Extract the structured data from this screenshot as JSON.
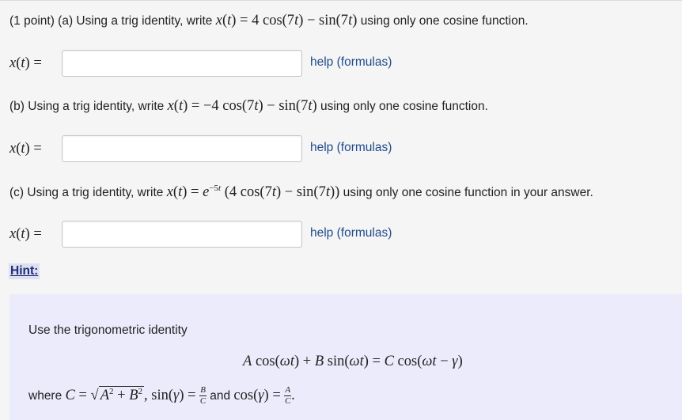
{
  "problem": {
    "part_a": {
      "intro": "(1 point) (a) Using a trig identity, write",
      "equation": "x(t) = 4 cos(7t) − sin(7t)",
      "suffix": "using only one cosine function."
    },
    "part_b": {
      "intro": "(b) Using a trig identity, write",
      "equation": "x(t) = −4 cos(7t) − sin(7t)",
      "suffix": "using only one cosine function."
    },
    "part_c": {
      "intro": "(c) Using a trig identity, write",
      "equation": "x(t) = e^{−5t} (4 cos(7t) − sin(7t))",
      "suffix": "using only one cosine function in your answer."
    }
  },
  "answers": {
    "label": "x(t) =",
    "a_value": "",
    "b_value": "",
    "c_value": "",
    "help_label": "help (formulas)"
  },
  "hint": {
    "link_label": "Hint:",
    "text": "Use the trigonometric identity",
    "identity": "A cos(ωt) + B sin(ωt) = C cos(ωt − γ)",
    "where_prefix": "where",
    "where_formula": "C = √(A² + B²), sin(γ) = B/C",
    "and_word": "and",
    "cos_formula": "cos(γ) = A/C."
  }
}
